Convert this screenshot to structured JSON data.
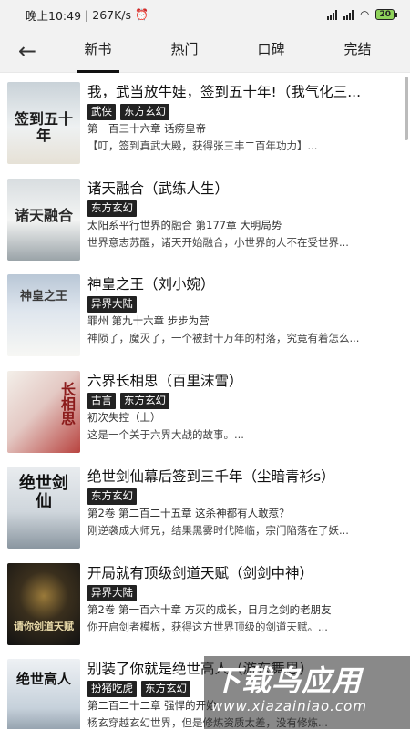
{
  "status": {
    "time": "晚上10:49",
    "speed": "267K/s",
    "battery": "20"
  },
  "nav": {
    "back_icon": "arrow-left-icon",
    "tabs": [
      {
        "label": "新书",
        "active": true
      },
      {
        "label": "热门",
        "active": false
      },
      {
        "label": "口碑",
        "active": false
      },
      {
        "label": "完结",
        "active": false
      }
    ]
  },
  "books": [
    {
      "title": "我，武当放牛娃，签到五十年!（我气化三...",
      "tags": [
        "武侠",
        "东方玄幻"
      ],
      "chapter": "第一百三十六章 话痨皇帝",
      "desc": "【叮，签到真武大殿，获得张三丰二百年功力】...",
      "cover_text": "签到五十年"
    },
    {
      "title": "诸天融合（武练人生）",
      "tags": [
        "东方玄幻"
      ],
      "chapter": "太阳系平行世界的融合 第177章 大明局势",
      "desc": "世界意志苏醒，诸天开始融合，小世界的人不在受世界...",
      "cover_text": "诸天融合"
    },
    {
      "title": "神皇之王（刘小婉）",
      "tags": [
        "异界大陆"
      ],
      "chapter": "罪州 第九十六章 步步为营",
      "desc": "神陨了，魔灭了，一个被封十万年的村落，究竟有着怎么...",
      "cover_text": "神皇之王"
    },
    {
      "title": "六界长相思（百里沫雪）",
      "tags": [
        "古言",
        "东方玄幻"
      ],
      "chapter": "初次失控（上）",
      "desc": "这是一个关于六界大战的故事。...",
      "cover_text": "长相思"
    },
    {
      "title": "绝世剑仙幕后签到三千年（尘暗青衫s）",
      "tags": [
        "东方玄幻"
      ],
      "chapter": "第2卷 第二百二十五章 这杀神都有人敢惹？",
      "desc": "刚逆袭成大师兄，结果黑雾时代降临，宗门陷落在了妖...",
      "cover_text": "绝世剑仙"
    },
    {
      "title": "开局就有顶级剑道天赋（剑剑中神）",
      "tags": [
        "异界大陆"
      ],
      "chapter": "第2卷 第一百六十章 方灭的成长，日月之剑的老朋友",
      "desc": "你开启剑者模板，获得这方世界顶级的剑道天赋。...",
      "cover_text": "请你剑道天赋"
    },
    {
      "title": "别装了你就是绝世高人（游东舞思）",
      "tags": [
        "扮猪吃虎",
        "东方玄幻"
      ],
      "chapter": "第二百二十二章 强悍的开始",
      "desc": "杨玄穿越玄幻世界，但是修炼资质太差，没有修炼...",
      "cover_text": "绝世高人"
    }
  ],
  "watermark": {
    "main": "下载鸟应用",
    "sub": "www.xiazainiao.com"
  },
  "colors": {
    "tag_bg": "#222222",
    "nav_bg": "#f2f2f2"
  }
}
